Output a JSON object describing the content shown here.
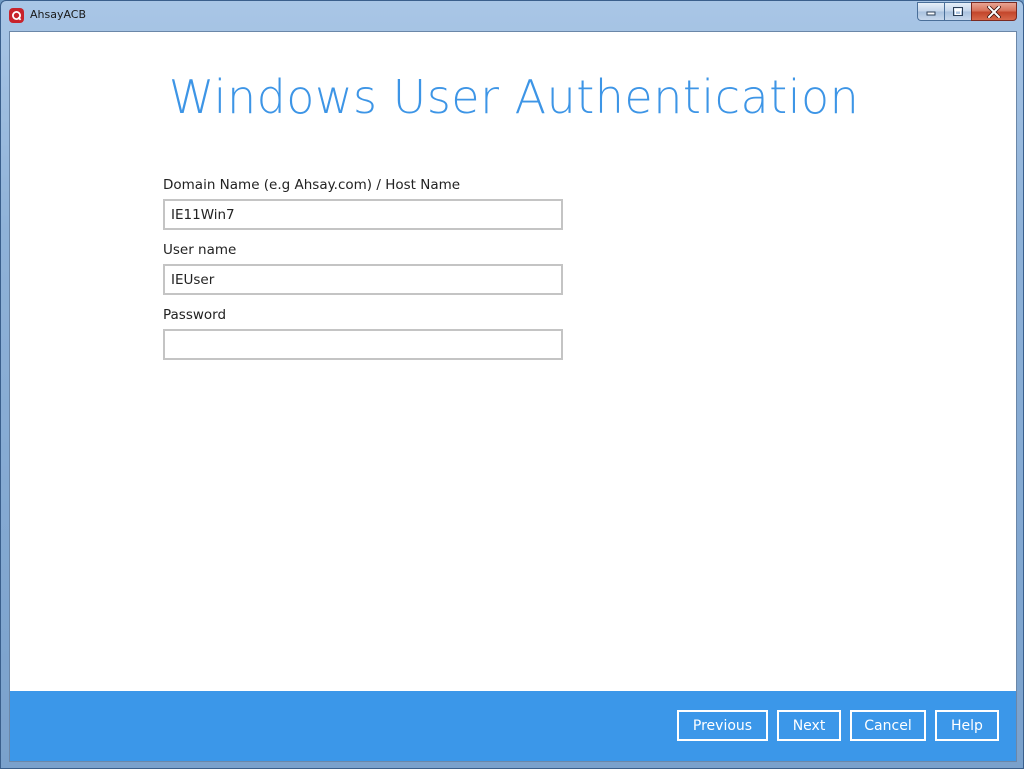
{
  "window": {
    "title": "AhsayACB",
    "controls": {
      "minimize_icon": "minimize-icon",
      "maximize_icon": "maximize-icon",
      "close_icon": "close-icon"
    }
  },
  "colors": {
    "accent": "#3d95e6",
    "footer": "#3b97e9",
    "logo": "#c8232c"
  },
  "main": {
    "title": "Windows User Authentication",
    "fields": [
      {
        "label": "Domain Name (e.g Ahsay.com) / Host Name",
        "value": "IE11Win7",
        "placeholder": ""
      },
      {
        "label": "User name",
        "value": "IEUser",
        "placeholder": ""
      },
      {
        "label": "Password",
        "value": "",
        "placeholder": ""
      }
    ]
  },
  "footer": {
    "previous_label": "Previous",
    "next_label": "Next",
    "cancel_label": "Cancel",
    "help_label": "Help"
  }
}
